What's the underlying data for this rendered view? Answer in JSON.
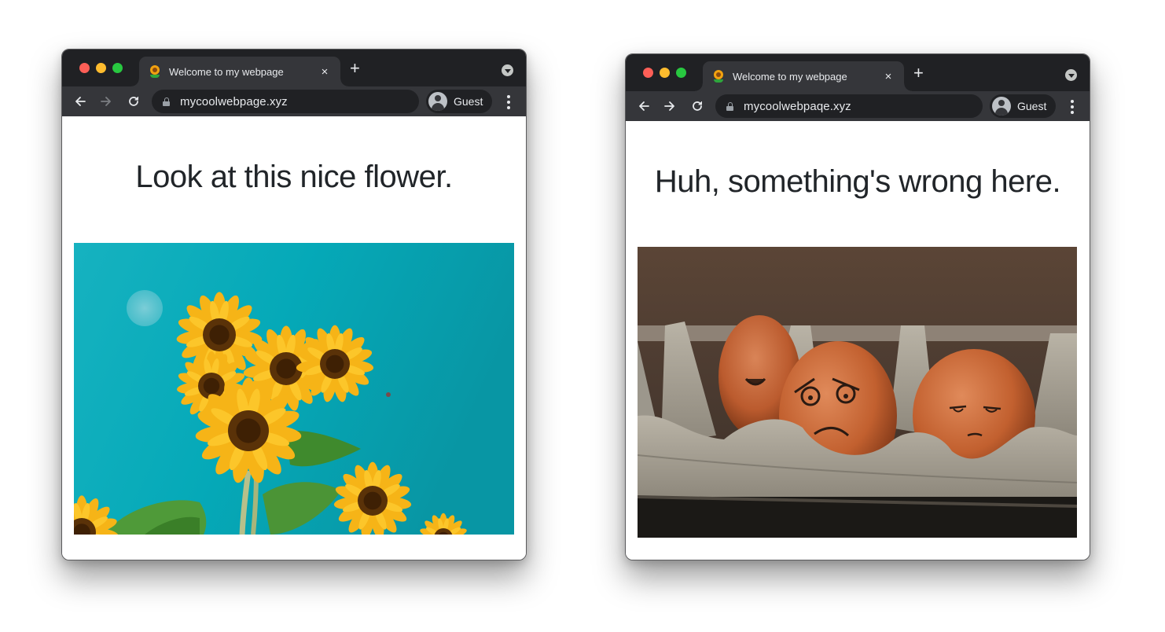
{
  "windows": [
    {
      "tab": {
        "title": "Welcome to my webpage",
        "favicon": "sunflower-icon",
        "close_label": "×"
      },
      "new_tab_label": "+",
      "address_bar": {
        "url": "mycoolwebpage.xyz",
        "secure_icon": "lock-icon"
      },
      "nav": {
        "back_enabled": true,
        "forward_enabled": false,
        "reload": true
      },
      "profile": {
        "name": "Guest",
        "icon": "account-circle-icon"
      },
      "page": {
        "heading": "Look at this nice flower.",
        "image": {
          "description": "Yellow sunflowers with green leaves against a turquoise sky",
          "alt": "sunflowers"
        }
      }
    },
    {
      "tab": {
        "title": "Welcome to my webpage",
        "favicon": "sunflower-icon",
        "close_label": "×"
      },
      "new_tab_label": "+",
      "address_bar": {
        "url": "mycoolwebpaqe.xyz",
        "secure_icon": "lock-icon"
      },
      "nav": {
        "back_enabled": true,
        "forward_enabled": true,
        "reload": true
      },
      "profile": {
        "name": "Guest",
        "icon": "account-circle-icon"
      },
      "page": {
        "heading": "Huh, something's wrong here.",
        "image": {
          "description": "Brown eggs with drawn sad and worried faces in a grey egg carton",
          "alt": "eggs with faces"
        }
      }
    }
  ],
  "colors": {
    "tabbar_bg": "#202124",
    "toolbar_bg": "#35363a",
    "omnibox_bg": "#202124",
    "text_light": "#e8eaed",
    "heading_text": "#212529",
    "traffic_red": "#fe5f57",
    "traffic_yellow": "#febc2e",
    "traffic_green": "#28c840"
  }
}
